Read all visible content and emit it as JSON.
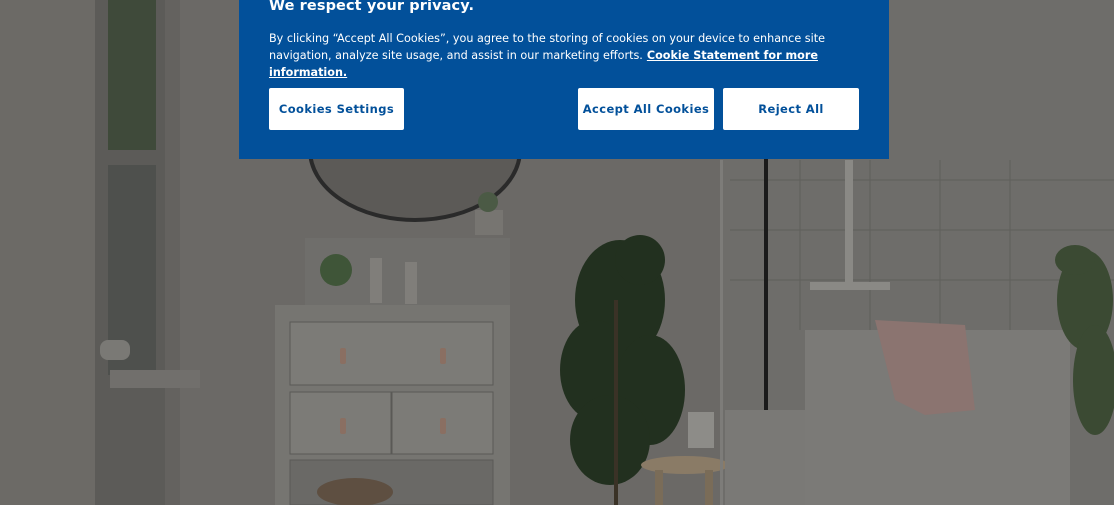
{
  "cookie_banner": {
    "title": "We respect your privacy.",
    "body_text": "By clicking “Accept All Cookies”, you agree to the storing of cookies on your device to enhance site navigation, analyze site usage, and assist in our marketing efforts.",
    "link_text": "Cookie Statement for more information.",
    "buttons": {
      "settings": "Cookies Settings",
      "accept": "Accept All Cookies",
      "reject": "Reject All"
    }
  },
  "colors": {
    "banner_background": "#02509a",
    "button_background": "#ffffff",
    "button_text": "#02509a"
  }
}
